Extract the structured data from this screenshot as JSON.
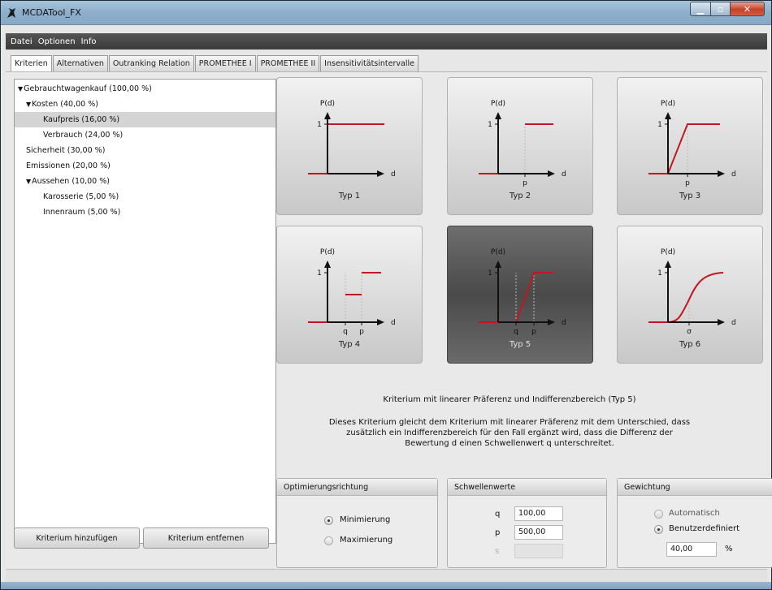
{
  "window": {
    "title": "MCDATool_FX",
    "icon": "tool-icon",
    "controls": [
      "minimize-icon",
      "maximize-icon",
      "close-icon"
    ]
  },
  "menu": [
    "Datei",
    "Optionen",
    "Info"
  ],
  "tabs": [
    {
      "label": "Kriterien",
      "active": true
    },
    {
      "label": "Alternativen",
      "active": false
    },
    {
      "label": "Outranking Relation",
      "active": false
    },
    {
      "label": "PROMETHEE I",
      "active": false
    },
    {
      "label": "PROMETHEE II",
      "active": false
    },
    {
      "label": "Insensitivitätsintervalle",
      "active": false
    }
  ],
  "tree": [
    {
      "label": "Gebrauchtwagenkauf (100,00 %)",
      "level": 0,
      "expanded": true,
      "selected": false
    },
    {
      "label": "Kosten (40,00 %)",
      "level": 1,
      "expanded": true,
      "selected": false
    },
    {
      "label": "Kaufpreis (16,00 %)",
      "level": 2,
      "selected": true
    },
    {
      "label": "Verbrauch (24,00 %)",
      "level": 2,
      "selected": false
    },
    {
      "label": "Sicherheit (30,00 %)",
      "level": 1,
      "selected": false
    },
    {
      "label": "Emissionen (20,00 %)",
      "level": 1,
      "selected": false
    },
    {
      "label": "Aussehen (10,00 %)",
      "level": 1,
      "expanded": true,
      "selected": false
    },
    {
      "label": "Karosserie (5,00 %)",
      "level": 2,
      "selected": false
    },
    {
      "label": "Innenraum (5,00 %)",
      "level": 2,
      "selected": false
    }
  ],
  "buttons": {
    "add": "Kriterium hinzufügen",
    "remove": "Kriterium entfernen"
  },
  "types": [
    {
      "label": "Typ 1",
      "active": false,
      "axis_y": "P(d)",
      "axis_x": "d",
      "one": "1",
      "marks": []
    },
    {
      "label": "Typ 2",
      "active": false,
      "axis_y": "P(d)",
      "axis_x": "d",
      "one": "1",
      "marks": [
        "p"
      ]
    },
    {
      "label": "Typ 3",
      "active": false,
      "axis_y": "P(d)",
      "axis_x": "d",
      "one": "1",
      "marks": [
        "p"
      ]
    },
    {
      "label": "Typ 4",
      "active": false,
      "axis_y": "P(d)",
      "axis_x": "d",
      "one": "1",
      "marks": [
        "q",
        "p"
      ]
    },
    {
      "label": "Typ 5",
      "active": true,
      "axis_y": "P(d)",
      "axis_x": "d",
      "one": "1",
      "marks": [
        "q",
        "p"
      ]
    },
    {
      "label": "Typ 6",
      "active": false,
      "axis_y": "P(d)",
      "axis_x": "d",
      "one": "1",
      "marks": [
        "σ"
      ]
    }
  ],
  "description": {
    "title": "Kriterium mit linearer Präferenz und Indifferenzbereich (Typ 5)",
    "body": "Dieses Kriterium gleicht dem Kriterium mit linearer Präferenz mit dem Unterschied, dass zusätzlich ein Indifferenzbereich für den Fall ergänzt wird, dass die Differenz der Bewertung d einen Schwellenwert q unterschreitet."
  },
  "optimization": {
    "header": "Optimierungsrichtung",
    "options": [
      {
        "label": "Minimierung",
        "selected": true
      },
      {
        "label": "Maximierung",
        "selected": false
      }
    ]
  },
  "thresholds": {
    "header": "Schwellenwerte",
    "fields": [
      {
        "label": "q",
        "value": "100,00",
        "enabled": true
      },
      {
        "label": "p",
        "value": "500,00",
        "enabled": true
      },
      {
        "label": "s",
        "value": "",
        "enabled": false
      }
    ]
  },
  "weighting": {
    "header": "Gewichtung",
    "options": [
      {
        "label": "Automatisch",
        "selected": false
      },
      {
        "label": "Benutzerdefiniert",
        "selected": true
      }
    ],
    "value": "40,00",
    "unit": "%"
  },
  "colors": {
    "curve": "#c0181e",
    "titlebar": "#98b6d1",
    "menubar": "#474747"
  }
}
